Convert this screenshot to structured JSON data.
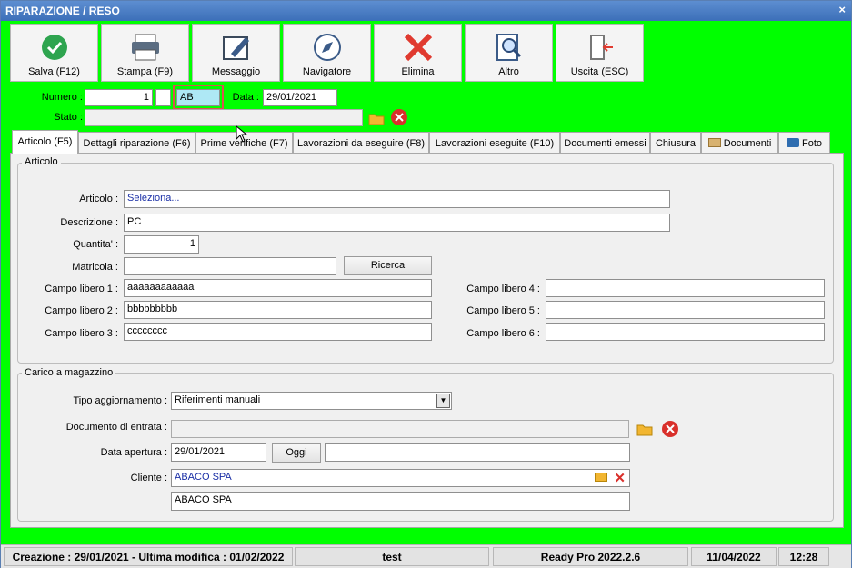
{
  "window": {
    "title": "RIPARAZIONE / RESO",
    "close": "×"
  },
  "toolbar": [
    {
      "label": "Salva (F12)",
      "icon": "check-icon"
    },
    {
      "label": "Stampa (F9)",
      "icon": "printer-icon"
    },
    {
      "label": "Messaggio",
      "icon": "message-icon"
    },
    {
      "label": "Navigatore",
      "icon": "compass-icon"
    },
    {
      "label": "Elimina",
      "icon": "delete-icon"
    },
    {
      "label": "Altro",
      "icon": "search-doc-icon"
    },
    {
      "label": "Uscita (ESC)",
      "icon": "exit-icon"
    }
  ],
  "header": {
    "numero_label": "Numero :",
    "numero_value": "1",
    "serie_value": "",
    "suffix_value": "AB",
    "data_label": "Data :",
    "data_value": "29/01/2021",
    "stato_label": "Stato :",
    "stato_value": ""
  },
  "tabs": [
    "Articolo (F5)",
    "Dettagli riparazione (F6)",
    "Prime verifiche (F7)",
    "Lavorazioni da eseguire (F8)",
    "Lavorazioni eseguite (F10)",
    "Documenti emessi",
    "Chiusura",
    "Documenti",
    "Foto"
  ],
  "articolo": {
    "group_title": "Articolo",
    "articolo_label": "Articolo :",
    "articolo_value": "Seleziona...",
    "descrizione_label": "Descrizione :",
    "descrizione_value": "PC",
    "quantita_label": "Quantita' :",
    "quantita_value": "1",
    "matricola_label": "Matricola :",
    "matricola_value": "",
    "ricerca_label": "Ricerca",
    "campi": [
      {
        "label": "Campo libero 1 :",
        "value": "aaaaaaaaaaaa"
      },
      {
        "label": "Campo libero 2 :",
        "value": "bbbbbbbbb"
      },
      {
        "label": "Campo libero 3 :",
        "value": "cccccccc"
      },
      {
        "label": "Campo libero 4 :",
        "value": ""
      },
      {
        "label": "Campo libero 5 :",
        "value": ""
      },
      {
        "label": "Campo libero 6 :",
        "value": ""
      }
    ]
  },
  "carico": {
    "group_title": "Carico a magazzino",
    "tipo_label": "Tipo aggiornamento :",
    "tipo_value": "Riferimenti manuali",
    "documento_label": "Documento di entrata :",
    "documento_value": "",
    "data_apertura_label": "Data apertura :",
    "data_apertura_value": "29/01/2021",
    "oggi_label": "Oggi",
    "data_extra_value": "",
    "cliente_label": "Cliente :",
    "cliente_code": "ABACO SPA",
    "cliente_name": "ABACO SPA"
  },
  "statusbar": {
    "info": "Creazione : 29/01/2021 - Ultima modifica : 01/02/2022",
    "user": "test",
    "app": "Ready Pro 2022.2.6",
    "date": "11/04/2022",
    "time": "12:28"
  },
  "colors": {
    "background": "#00ff00",
    "titlebar": "#4a7fc4",
    "delete": "#e03a2f",
    "link": "#1a2fa6"
  }
}
